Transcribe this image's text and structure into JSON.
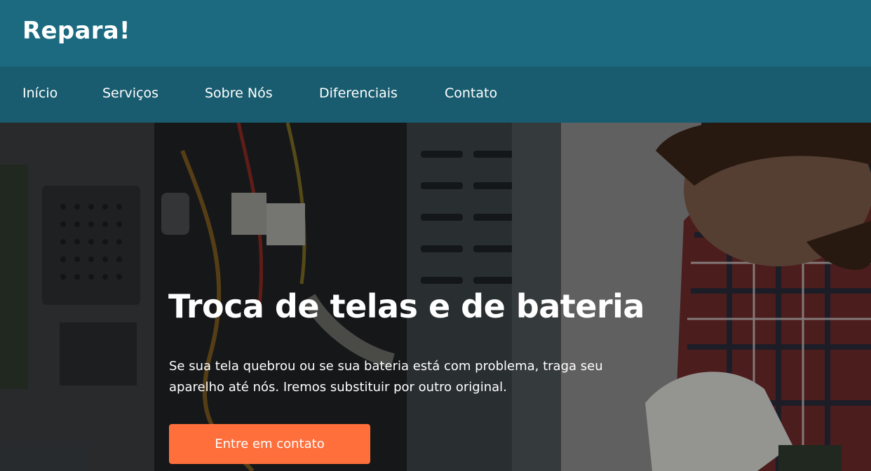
{
  "brand": {
    "logo_text": "Repara!"
  },
  "nav": {
    "items": [
      {
        "label": "Início"
      },
      {
        "label": "Serviços"
      },
      {
        "label": "Sobre Nós"
      },
      {
        "label": "Diferenciais"
      },
      {
        "label": "Contato"
      }
    ]
  },
  "hero": {
    "title": "Troca de telas e de bateria",
    "description": "Se sua tela quebrou ou se sua bateria está com problema, traga seu aparelho até nós. Iremos substituir por outro original.",
    "cta_label": "Entre em contato",
    "background_image": "technician-repairing-computer-photo"
  },
  "colors": {
    "header_bg": "#1b6a80",
    "nav_bg": "#195c6f",
    "cta_bg": "#ff6f3c",
    "text": "#ffffff"
  }
}
